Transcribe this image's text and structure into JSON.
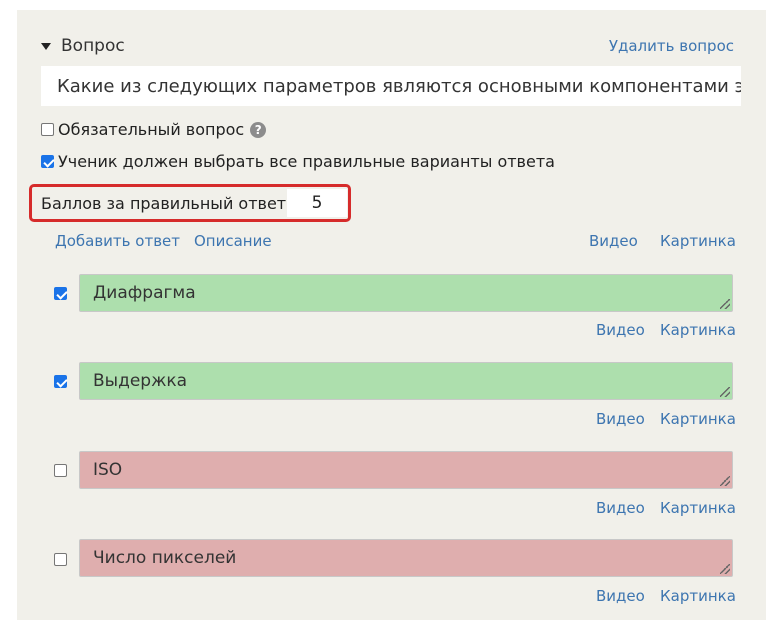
{
  "question": {
    "toggle_label": "Вопрос",
    "delete_label": "Удалить вопрос",
    "text": "Какие из следующих параметров являются основными компонентами экспозиции?"
  },
  "options": {
    "required_label": "Обязательный вопрос",
    "required_checked": false,
    "all_correct_label": "Ученик должен выбрать все правильные варианты ответа",
    "all_correct_checked": true
  },
  "score": {
    "label": "Баллов за правильный ответ:",
    "value": "5"
  },
  "actions": {
    "add_answer": "Добавить ответ",
    "description": "Описание",
    "video": "Видео",
    "picture": "Картинка"
  },
  "answers": [
    {
      "text": "Диафрагма",
      "checked": true,
      "status": "correct",
      "video": "Видео",
      "picture": "Картинка"
    },
    {
      "text": "Выдержка",
      "checked": true,
      "status": "correct",
      "video": "Видео",
      "picture": "Картинка"
    },
    {
      "text": "ISO",
      "checked": false,
      "status": "wrong",
      "video": "Видео",
      "picture": "Картинка"
    },
    {
      "text": "Число пикселей",
      "checked": false,
      "status": "wrong",
      "video": "Видео",
      "picture": "Картинка"
    }
  ],
  "colors": {
    "panel_bg": "#f1f0ea",
    "link": "#3d75b0",
    "correct_bg": "#addfad",
    "wrong_bg": "#dfaeae",
    "highlight_border": "#d62b2b",
    "checkbox_checked": "#1a73e8"
  }
}
